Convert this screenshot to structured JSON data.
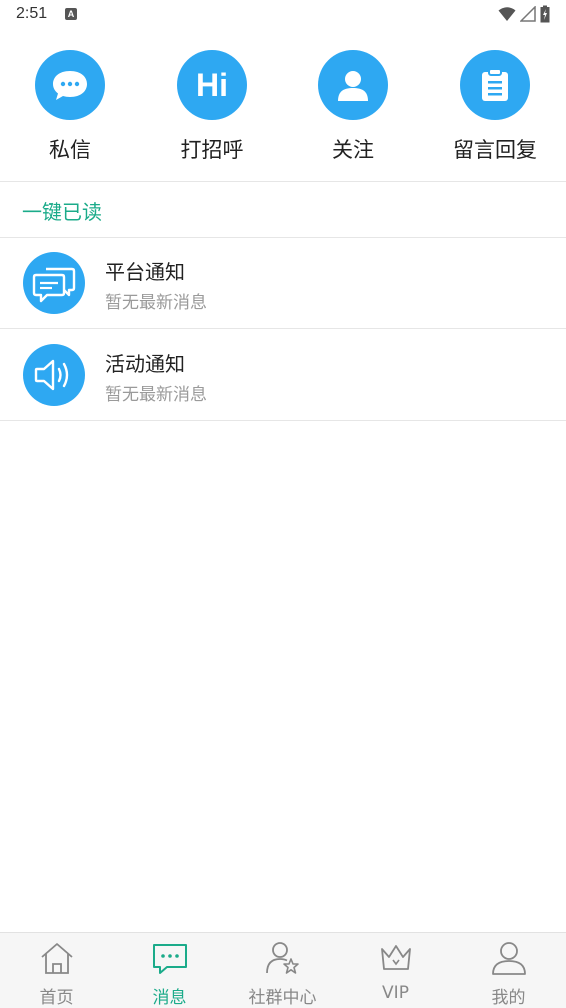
{
  "status_bar": {
    "time": "2:51",
    "keyboard_indicator": "A",
    "icons": [
      "wifi-icon",
      "signal-icon",
      "battery-charging-icon"
    ]
  },
  "quick_actions": [
    {
      "label": "私信",
      "icon": "chat-bubble-icon"
    },
    {
      "label": "打招呼",
      "icon": "hi-icon",
      "icon_text": "Hi"
    },
    {
      "label": "关注",
      "icon": "person-icon"
    },
    {
      "label": "留言回复",
      "icon": "clipboard-icon"
    }
  ],
  "mark_all_read": "一键已读",
  "notices": [
    {
      "title": "平台通知",
      "subtitle": "暂无最新消息",
      "icon": "chat-bubbles-icon"
    },
    {
      "title": "活动通知",
      "subtitle": "暂无最新消息",
      "icon": "speaker-icon"
    }
  ],
  "tabbar": {
    "tabs": [
      {
        "label": "首页",
        "icon": "home-icon",
        "active": false
      },
      {
        "label": "消息",
        "icon": "message-icon",
        "active": true
      },
      {
        "label": "社群中心",
        "icon": "community-icon",
        "active": false
      },
      {
        "label": "VIP",
        "icon": "crown-icon",
        "active": false
      },
      {
        "label": "我的",
        "icon": "profile-icon",
        "active": false
      }
    ]
  },
  "colors": {
    "accent_blue": "#2ea8f2",
    "accent_green": "#1bab8a",
    "muted_text": "#9a9a9a"
  }
}
